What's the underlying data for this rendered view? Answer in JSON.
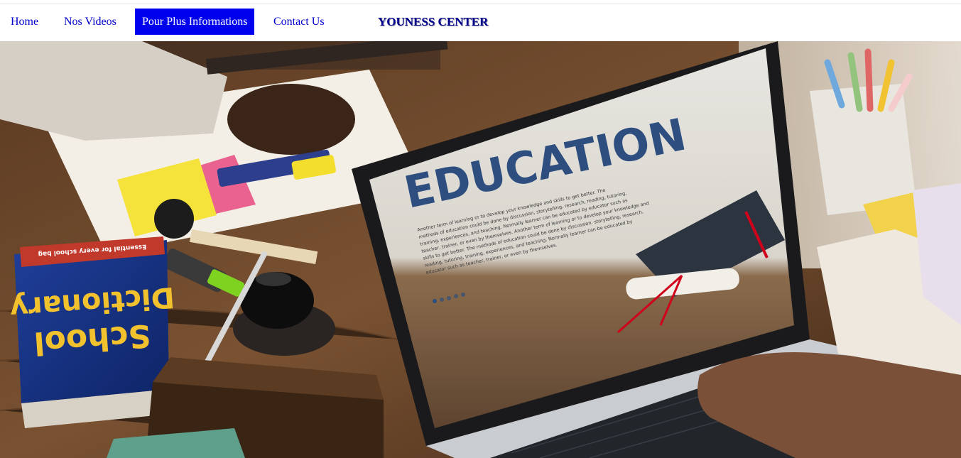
{
  "nav": {
    "items": [
      {
        "label": "Home"
      },
      {
        "label": "Nos Videos"
      },
      {
        "label": "Pour Plus Informations",
        "active": true
      },
      {
        "label": "Contact Us"
      }
    ],
    "brand": "YOUNESS CENTER",
    "active_color": "#0000ee",
    "link_color": "#0000cc"
  },
  "hero": {
    "screen_title": "EDUCATION",
    "screen_body": [
      "Another term of learning or to develop your knowledge and skills to get better. The",
      "methods of education could be done by discussion, storytelling, research, reading, tutoring,",
      "training, experiences, and teaching. Normally learner can be educated by educator such as",
      "teacher, trainer, or even by themselves. Another term of learning or to develop your knowledge and",
      "skills to get better. The methods of education could be done by discussion, storytelling, research,",
      "reading, tutoring, training, experiences, and teaching. Normally learner can be educated by",
      "educator such as teacher, trainer, or even by themselves."
    ],
    "book_title_line1": "School",
    "book_title_line2": "Dictionary",
    "book_banner": "Essential for every school bag"
  }
}
